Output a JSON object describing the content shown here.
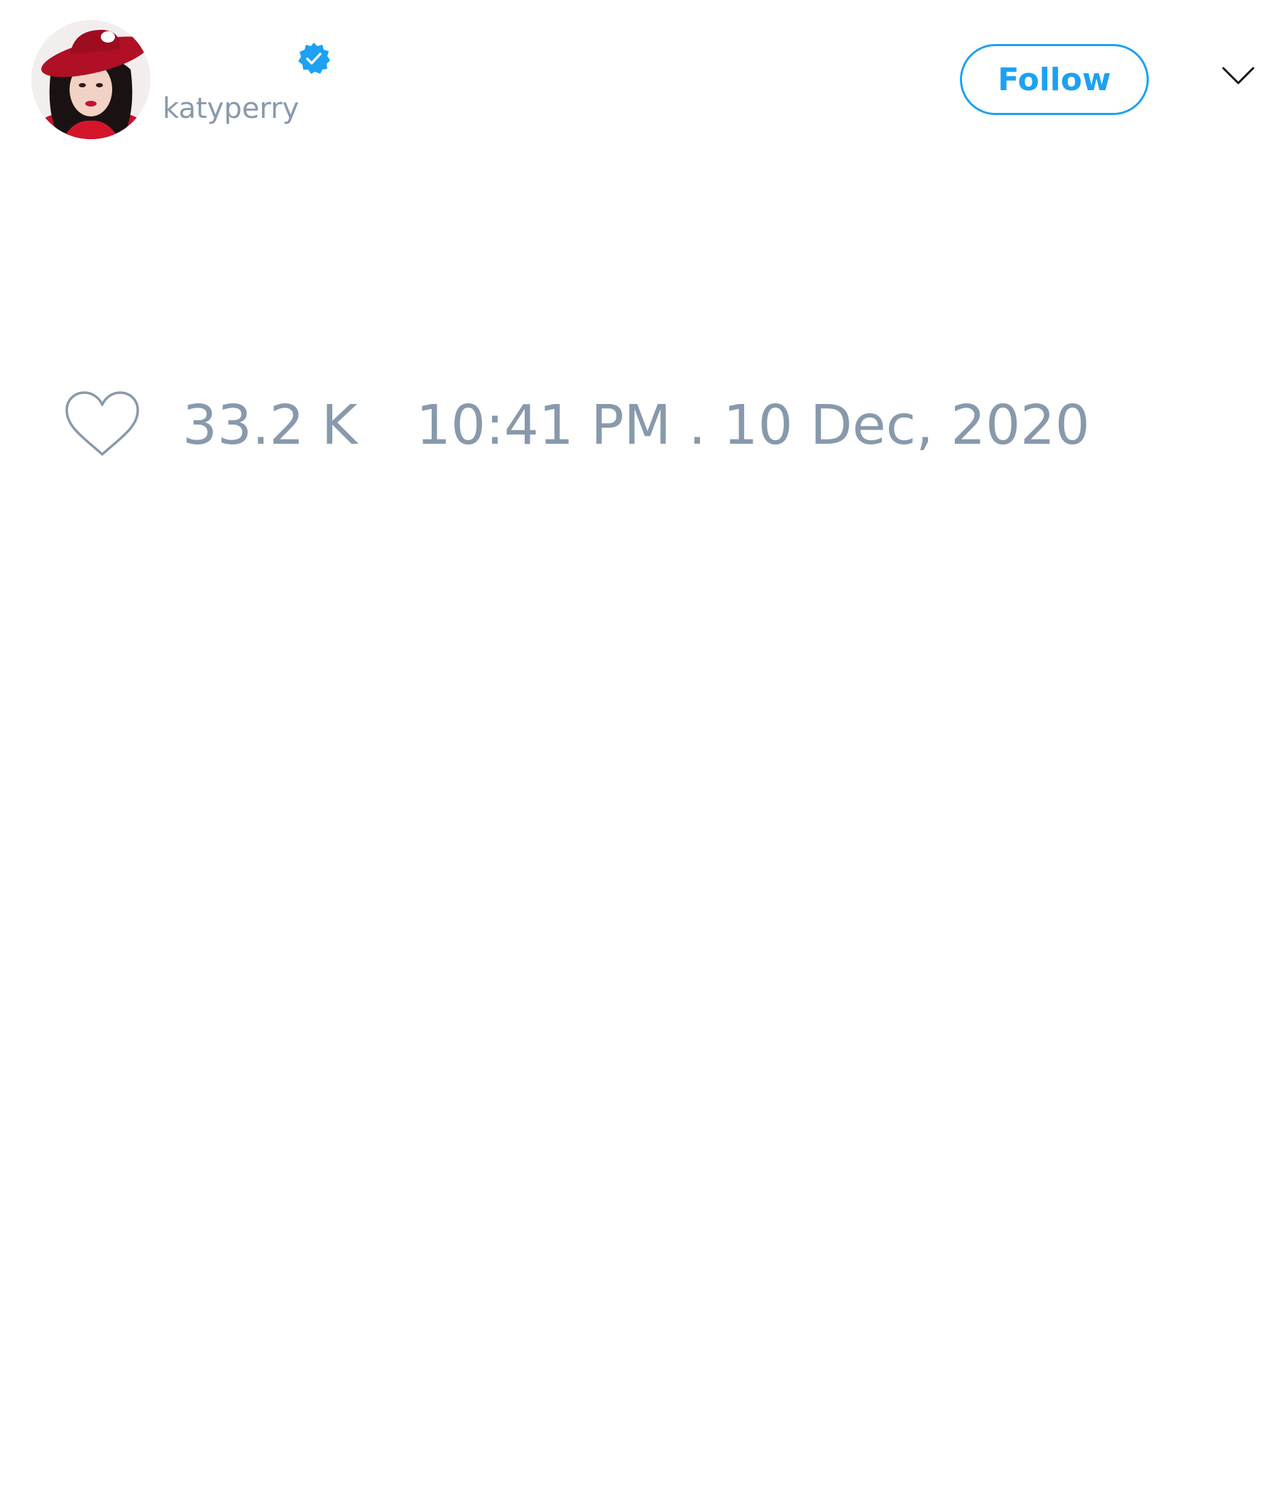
{
  "author": {
    "handle": "katyperry",
    "avatar": "profile-photo",
    "verified": true,
    "verified_icon": "verified-badge-icon"
  },
  "header": {
    "follow_label": "Follow",
    "menu_icon": "chevron-down-icon"
  },
  "tweet": {
    "like_icon": "heart-icon",
    "like_count": "33.2 K",
    "timestamp": "10:41 PM . 10 Dec, 2020"
  },
  "colors": {
    "accent": "#1da1f2",
    "secondary_text": "#8899ac",
    "background": "#ffffff"
  }
}
